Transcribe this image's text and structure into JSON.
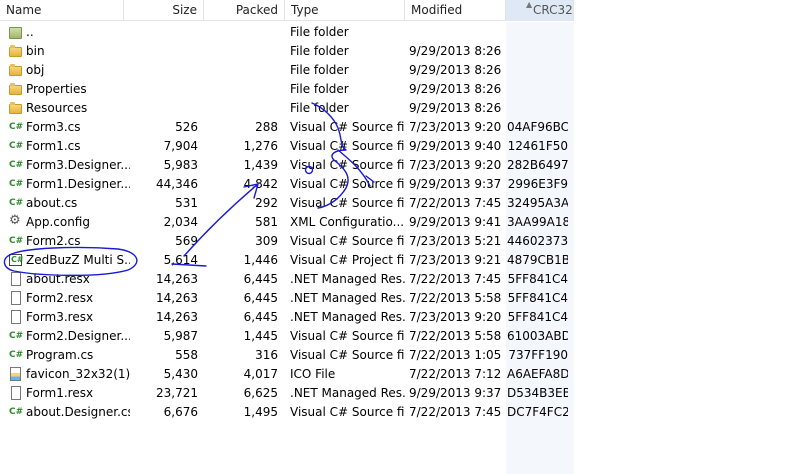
{
  "columns": {
    "name": "Name",
    "size": "Size",
    "packed": "Packed",
    "type": "Type",
    "modified": "Modified",
    "crc": "CRC32"
  },
  "rows": [
    {
      "name": "..",
      "size": "",
      "packed": "",
      "type": "File folder",
      "modified": "",
      "crc": "",
      "icon": "updir-icon"
    },
    {
      "name": "bin",
      "size": "",
      "packed": "",
      "type": "File folder",
      "modified": "9/29/2013 8:26 ...",
      "crc": "",
      "icon": "folder-icon"
    },
    {
      "name": "obj",
      "size": "",
      "packed": "",
      "type": "File folder",
      "modified": "9/29/2013 8:26 ...",
      "crc": "",
      "icon": "folder-icon"
    },
    {
      "name": "Properties",
      "size": "",
      "packed": "",
      "type": "File folder",
      "modified": "9/29/2013 8:26 ...",
      "crc": "",
      "icon": "folder-icon"
    },
    {
      "name": "Resources",
      "size": "",
      "packed": "",
      "type": "File folder",
      "modified": "9/29/2013 8:26 ...",
      "crc": "",
      "icon": "folder-icon"
    },
    {
      "name": "Form3.cs",
      "size": "526",
      "packed": "288",
      "type": "Visual C# Source file",
      "modified": "7/23/2013 9:20 ...",
      "crc": "04AF96BC",
      "icon": "csharp-file-icon"
    },
    {
      "name": "Form1.cs",
      "size": "7,904",
      "packed": "1,276",
      "type": "Visual C# Source file",
      "modified": "9/29/2013 9:40 ...",
      "crc": "12461F50",
      "icon": "csharp-file-icon"
    },
    {
      "name": "Form3.Designer....",
      "size": "5,983",
      "packed": "1,439",
      "type": "Visual C# Source file",
      "modified": "7/23/2013 9:20 ...",
      "crc": "282B6497",
      "icon": "csharp-file-icon"
    },
    {
      "name": "Form1.Designer....",
      "size": "44,346",
      "packed": "4,842",
      "type": "Visual C# Source file",
      "modified": "9/29/2013 9:37 ...",
      "crc": "2996E3F9",
      "icon": "csharp-file-icon"
    },
    {
      "name": "about.cs",
      "size": "531",
      "packed": "292",
      "type": "Visual C# Source file",
      "modified": "7/22/2013 7:45 ...",
      "crc": "32495A3A",
      "icon": "csharp-file-icon"
    },
    {
      "name": "App.config",
      "size": "2,034",
      "packed": "581",
      "type": "XML Configuratio...",
      "modified": "9/29/2013 9:41 ...",
      "crc": "3AA99A18",
      "icon": "config-file-icon"
    },
    {
      "name": "Form2.cs",
      "size": "569",
      "packed": "309",
      "type": "Visual C# Source file",
      "modified": "7/23/2013 5:21 ...",
      "crc": "44602373",
      "icon": "csharp-file-icon"
    },
    {
      "name": "ZedBuzZ Multi S...",
      "size": "5,614",
      "packed": "1,446",
      "type": "Visual C# Project file",
      "modified": "7/23/2013 9:21 ...",
      "crc": "4879CB1B",
      "icon": "csharp-project-icon"
    },
    {
      "name": "about.resx",
      "size": "14,263",
      "packed": "6,445",
      "type": ".NET Managed Res...",
      "modified": "7/22/2013 7:45 ...",
      "crc": "5FF841C4",
      "icon": "resx-file-icon"
    },
    {
      "name": "Form2.resx",
      "size": "14,263",
      "packed": "6,445",
      "type": ".NET Managed Res...",
      "modified": "7/22/2013 5:58 ...",
      "crc": "5FF841C4",
      "icon": "resx-file-icon"
    },
    {
      "name": "Form3.resx",
      "size": "14,263",
      "packed": "6,445",
      "type": ".NET Managed Res...",
      "modified": "7/23/2013 9:20 ...",
      "crc": "5FF841C4",
      "icon": "resx-file-icon"
    },
    {
      "name": "Form2.Designer....",
      "size": "5,987",
      "packed": "1,445",
      "type": "Visual C# Source file",
      "modified": "7/22/2013 5:58 ...",
      "crc": "61003ABD",
      "icon": "csharp-file-icon"
    },
    {
      "name": "Program.cs",
      "size": "558",
      "packed": "316",
      "type": "Visual C# Source file",
      "modified": "7/22/2013 1:05 ...",
      "crc": "737FF190",
      "icon": "csharp-file-icon"
    },
    {
      "name": "favicon_32x32(1)...",
      "size": "5,430",
      "packed": "4,017",
      "type": "ICO File",
      "modified": "7/22/2013 7:12 ...",
      "crc": "A6AEFA8D",
      "icon": "image-file-icon"
    },
    {
      "name": "Form1.resx",
      "size": "23,721",
      "packed": "6,625",
      "type": ".NET Managed Res...",
      "modified": "9/29/2013 9:37 ...",
      "crc": "D534B3EB",
      "icon": "resx-file-icon"
    },
    {
      "name": "about.Designer.cs",
      "size": "6,676",
      "packed": "1,495",
      "type": "Visual C# Source file",
      "modified": "7/22/2013 7:45 ...",
      "crc": "DC7F4FC2",
      "icon": "csharp-file-icon"
    }
  ],
  "colors": {
    "sorted_header": "#dfe9f5",
    "annotation_ink": "#1a1ad6",
    "csharp_icon": "#2e8a2e"
  }
}
